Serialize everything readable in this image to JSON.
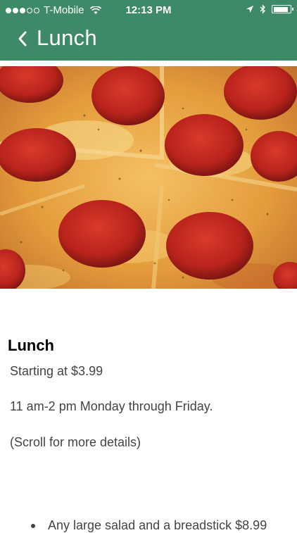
{
  "status_bar": {
    "carrier": "T-Mobile",
    "time": "12:13 PM",
    "signal_bars": 3,
    "signal_total": 5,
    "battery_level": 0.8
  },
  "nav": {
    "title": "Lunch"
  },
  "content": {
    "heading": "Lunch",
    "price": "Starting at $3.99",
    "hours": "11 am-2 pm Monday through Friday.",
    "scroll_note": "(Scroll for more details)",
    "items": [
      "Any large salad and a breadstick $8.99"
    ]
  },
  "colors": {
    "header": "#3e8a66",
    "text": "#444444"
  }
}
